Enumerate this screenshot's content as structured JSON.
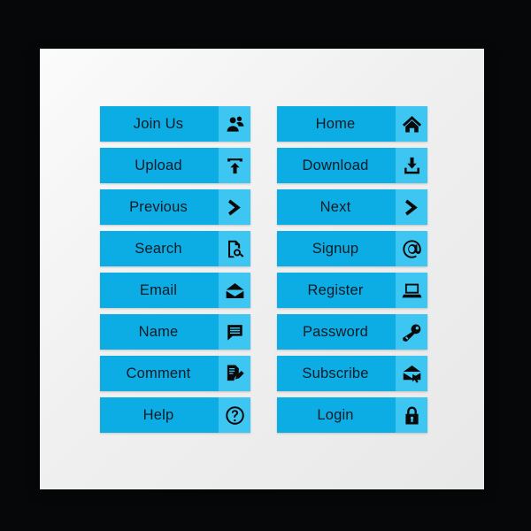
{
  "page": {
    "background_color": "#050708",
    "panel_color": "#f0f0f0",
    "button_color": "#0cade4",
    "icon_panel_color": "#3ec6f2",
    "label_color": "#101a24",
    "icon_color": "#0a0a0a"
  },
  "columns": [
    {
      "name": "left-column",
      "buttons": [
        {
          "label": "Join Us",
          "icon": "users-icon"
        },
        {
          "label": "Upload",
          "icon": "upload-arrow-icon"
        },
        {
          "label": "Previous",
          "icon": "chevron-right-icon"
        },
        {
          "label": "Search",
          "icon": "document-search-icon"
        },
        {
          "label": "Email",
          "icon": "envelope-icon"
        },
        {
          "label": "Name",
          "icon": "speech-bubble-icon"
        },
        {
          "label": "Comment",
          "icon": "document-pen-icon"
        },
        {
          "label": "Help",
          "icon": "question-circle-icon"
        }
      ]
    },
    {
      "name": "right-column",
      "buttons": [
        {
          "label": "Home",
          "icon": "home-icon"
        },
        {
          "label": "Download",
          "icon": "download-tray-icon"
        },
        {
          "label": "Next",
          "icon": "chevron-right-icon"
        },
        {
          "label": "Signup",
          "icon": "at-sign-icon"
        },
        {
          "label": "Register",
          "icon": "laptop-icon"
        },
        {
          "label": "Password",
          "icon": "key-icon"
        },
        {
          "label": "Subscribe",
          "icon": "envelope-cursor-icon"
        },
        {
          "label": "Login",
          "icon": "padlock-icon"
        }
      ]
    }
  ]
}
